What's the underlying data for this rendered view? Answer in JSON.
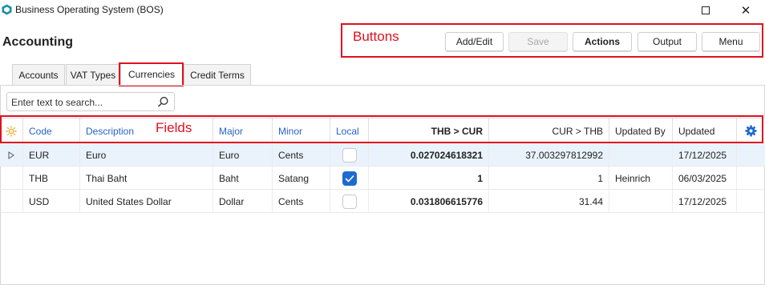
{
  "window": {
    "title": "Business Operating System (BOS)",
    "maximize_icon": "maximize-icon",
    "close_glyph": "✕"
  },
  "page": {
    "title": "Accounting"
  },
  "toolbar": {
    "add_edit": "Add/Edit",
    "save": "Save",
    "actions": "Actions",
    "output": "Output",
    "menu": "Menu"
  },
  "annotations": {
    "buttons": "Buttons",
    "fields": "Fields",
    "color": "#e0101e"
  },
  "tabs": [
    {
      "label": "Accounts",
      "active": false
    },
    {
      "label": "VAT Types",
      "active": false
    },
    {
      "label": "Currencies",
      "active": true
    },
    {
      "label": "Credit Terms",
      "active": false
    }
  ],
  "search": {
    "placeholder": "Enter text to search..."
  },
  "grid": {
    "columns": {
      "code": "Code",
      "description": "Description",
      "major": "Major",
      "minor": "Minor",
      "local": "Local",
      "thb_cur": "THB > CUR",
      "cur_thb": "CUR > THB",
      "updated_by": "Updated By",
      "updated": "Updated"
    },
    "rows": [
      {
        "code": "EUR",
        "description": "Euro",
        "major": "Euro",
        "minor": "Cents",
        "local": false,
        "thb_cur": "0.027024618321",
        "cur_thb": "37.003297812992",
        "updated_by": "",
        "updated": "17/12/2025",
        "selected": true
      },
      {
        "code": "THB",
        "description": "Thai Baht",
        "major": "Baht",
        "minor": "Satang",
        "local": true,
        "thb_cur": "1",
        "cur_thb": "1",
        "updated_by": "Heinrich",
        "updated": "06/03/2025",
        "selected": false
      },
      {
        "code": "USD",
        "description": "United States Dollar",
        "major": "Dollar",
        "minor": "Cents",
        "local": false,
        "thb_cur": "0.031806615776",
        "cur_thb": "31.44",
        "updated_by": "",
        "updated": "17/12/2025",
        "selected": false
      }
    ]
  },
  "colors": {
    "accent": "#1f6ad0",
    "header_link": "#2a62c9",
    "selected_row": "#eaf3fc",
    "gear": "#1f6ad0",
    "sun": "#f0a020"
  }
}
